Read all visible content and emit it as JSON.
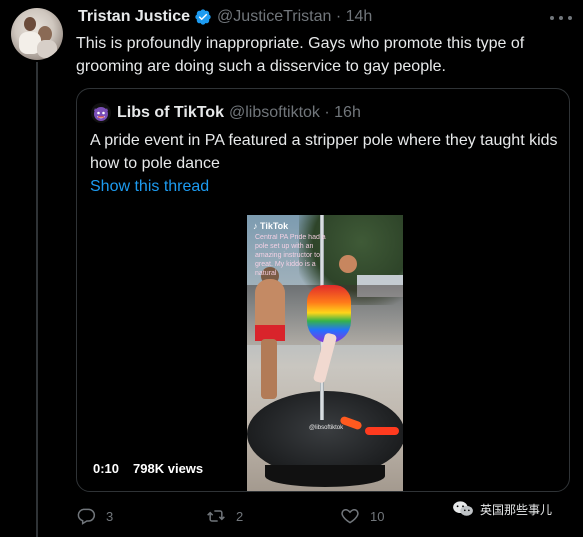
{
  "tweet": {
    "author_name": "Tristan Justice",
    "author_handle": "@JusticeTristan",
    "time": "14h",
    "text": "This is profoundly inappropriate. Gays who promote this type of grooming are doing such a disservice to gay people."
  },
  "quote": {
    "author_name": "Libs of TikTok",
    "author_handle": "@libsoftiktok",
    "time": "16h",
    "text": "A pride event in PA featured a stripper pole where they taught kids how to pole dance",
    "show_thread": "Show this thread",
    "video": {
      "overlay_brand": "TikTok",
      "overlay_text": "Central PA Pride had a pole set up with an amazing instructor to great. My kiddo is a natural",
      "watermark": "@libsoftiktok",
      "duration": "0:10",
      "views": "798K views"
    }
  },
  "actions": {
    "reply_count": "3",
    "retweet_count": "2",
    "like_count": "10"
  },
  "watermark": {
    "text": "英国那些事儿"
  },
  "colors": {
    "background": "#000000",
    "text": "#e7e9ea",
    "muted": "#71767b",
    "link": "#1d9bf0",
    "border": "#2f3336",
    "verified": "#1d9bf0"
  }
}
